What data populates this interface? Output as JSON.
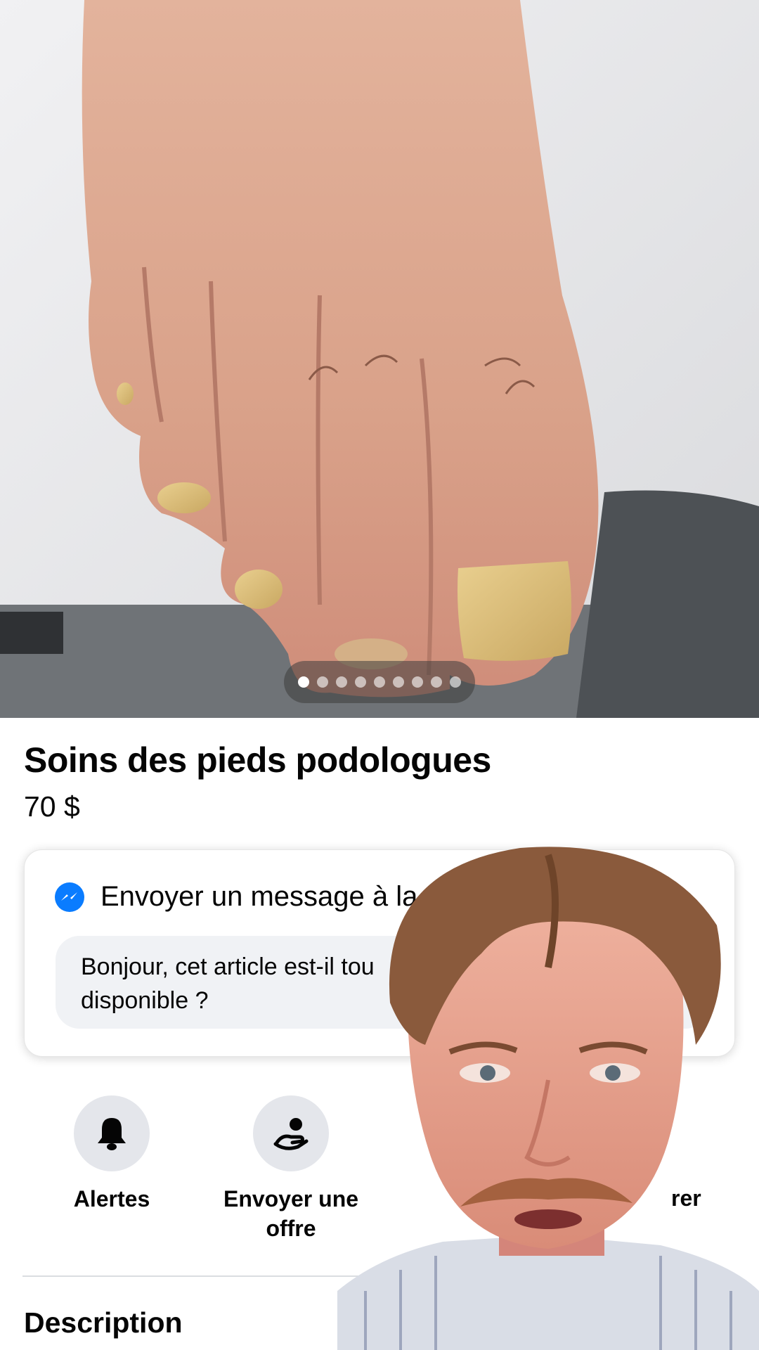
{
  "photo": {
    "carousel": {
      "total": 9,
      "active_index": 0
    }
  },
  "listing": {
    "title": "Soins des pieds podologues",
    "price": "70 $"
  },
  "message_card": {
    "header": "Envoyer un message à la p",
    "icon": "messenger-icon",
    "message_line1": "Bonjour, cet article est-il tou",
    "message_line2": "disponible ?"
  },
  "actions": [
    {
      "label_line1": "Alertes",
      "label_line2": "",
      "icon": "bell-icon"
    },
    {
      "label_line1": "Envoyer une",
      "label_line2": "offre",
      "icon": "offer-hand-icon"
    },
    {
      "label_line1": "rer",
      "label_line2": "",
      "icon": "share-icon"
    }
  ],
  "description": {
    "title": "Description"
  },
  "colors": {
    "messenger_blue": "#0a7cff",
    "chip_grey": "#e4e6eb",
    "input_grey": "#f0f2f5"
  }
}
